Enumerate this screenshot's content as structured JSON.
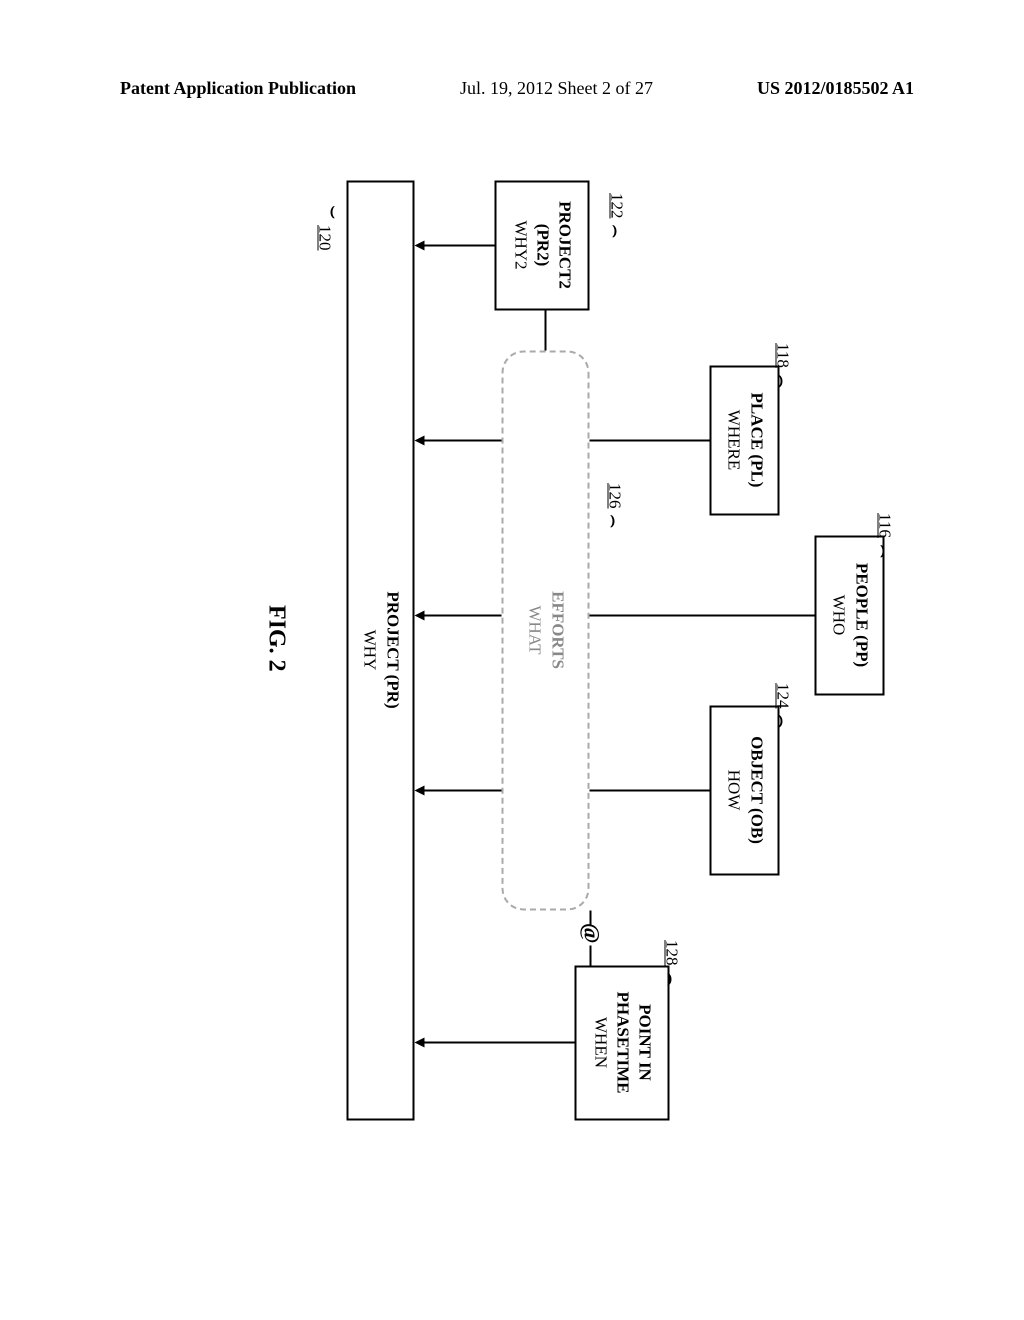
{
  "header": {
    "left": "Patent Application Publication",
    "center": "Jul. 19, 2012  Sheet 2 of 27",
    "right": "US 2012/0185502 A1"
  },
  "boxes": {
    "people": {
      "l1": "PEOPLE (PP)",
      "l2": "WHO",
      "ref": "116"
    },
    "place": {
      "l1": "PLACE (PL)",
      "l2": "WHERE",
      "ref": "118"
    },
    "project2": {
      "l1": "PROJECT2",
      "l2": "(PR2)",
      "l3": "WHY2",
      "ref": "122"
    },
    "object": {
      "l1": "OBJECT (OB)",
      "l2": "HOW",
      "ref": "124"
    },
    "phasetime": {
      "l1": "POINT IN",
      "l2": "PHASETIME",
      "l3": "WHEN",
      "ref": "128"
    },
    "efforts": {
      "l1": "EFFORTS",
      "l2": "WHAT",
      "ref": "126"
    },
    "project": {
      "l1": "PROJECT (PR)",
      "l2": "WHY",
      "ref": "120"
    }
  },
  "symbol_at": "@",
  "fig": "FIG. 2"
}
